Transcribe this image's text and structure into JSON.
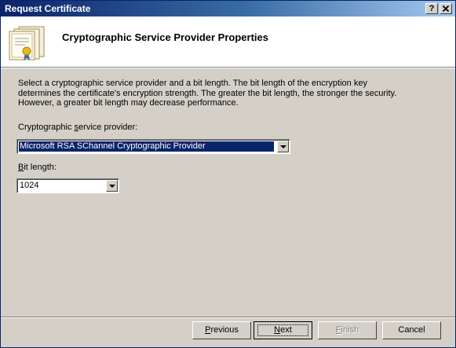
{
  "window": {
    "title": "Request Certificate",
    "help_label": "?",
    "close_label": "X"
  },
  "header": {
    "title": "Cryptographic Service Provider Properties"
  },
  "content": {
    "description": "Select a cryptographic service provider and a bit length. The bit length of the encryption key\ndetermines the certificate's encryption strength. The greater the bit length, the stronger the security.\nHowever, a greater bit length may decrease performance.",
    "csp_label_pre": "Cryptographic ",
    "csp_label_key": "s",
    "csp_label_post": "ervice provider:",
    "csp_value": "Microsoft RSA SChannel Cryptographic Provider",
    "bit_label_key": "B",
    "bit_label_post": "it length:",
    "bit_value": "1024"
  },
  "buttons": {
    "previous_key": "P",
    "previous_rest": "revious",
    "next_key": "N",
    "next_rest": "ext",
    "finish_key": "F",
    "finish_rest": "inish",
    "cancel": "Cancel"
  },
  "colors": {
    "titlebar_start": "#0a246a",
    "titlebar_end": "#a6caf0",
    "selection": "#0a246a",
    "dialog_bg": "#d4d0c8"
  }
}
